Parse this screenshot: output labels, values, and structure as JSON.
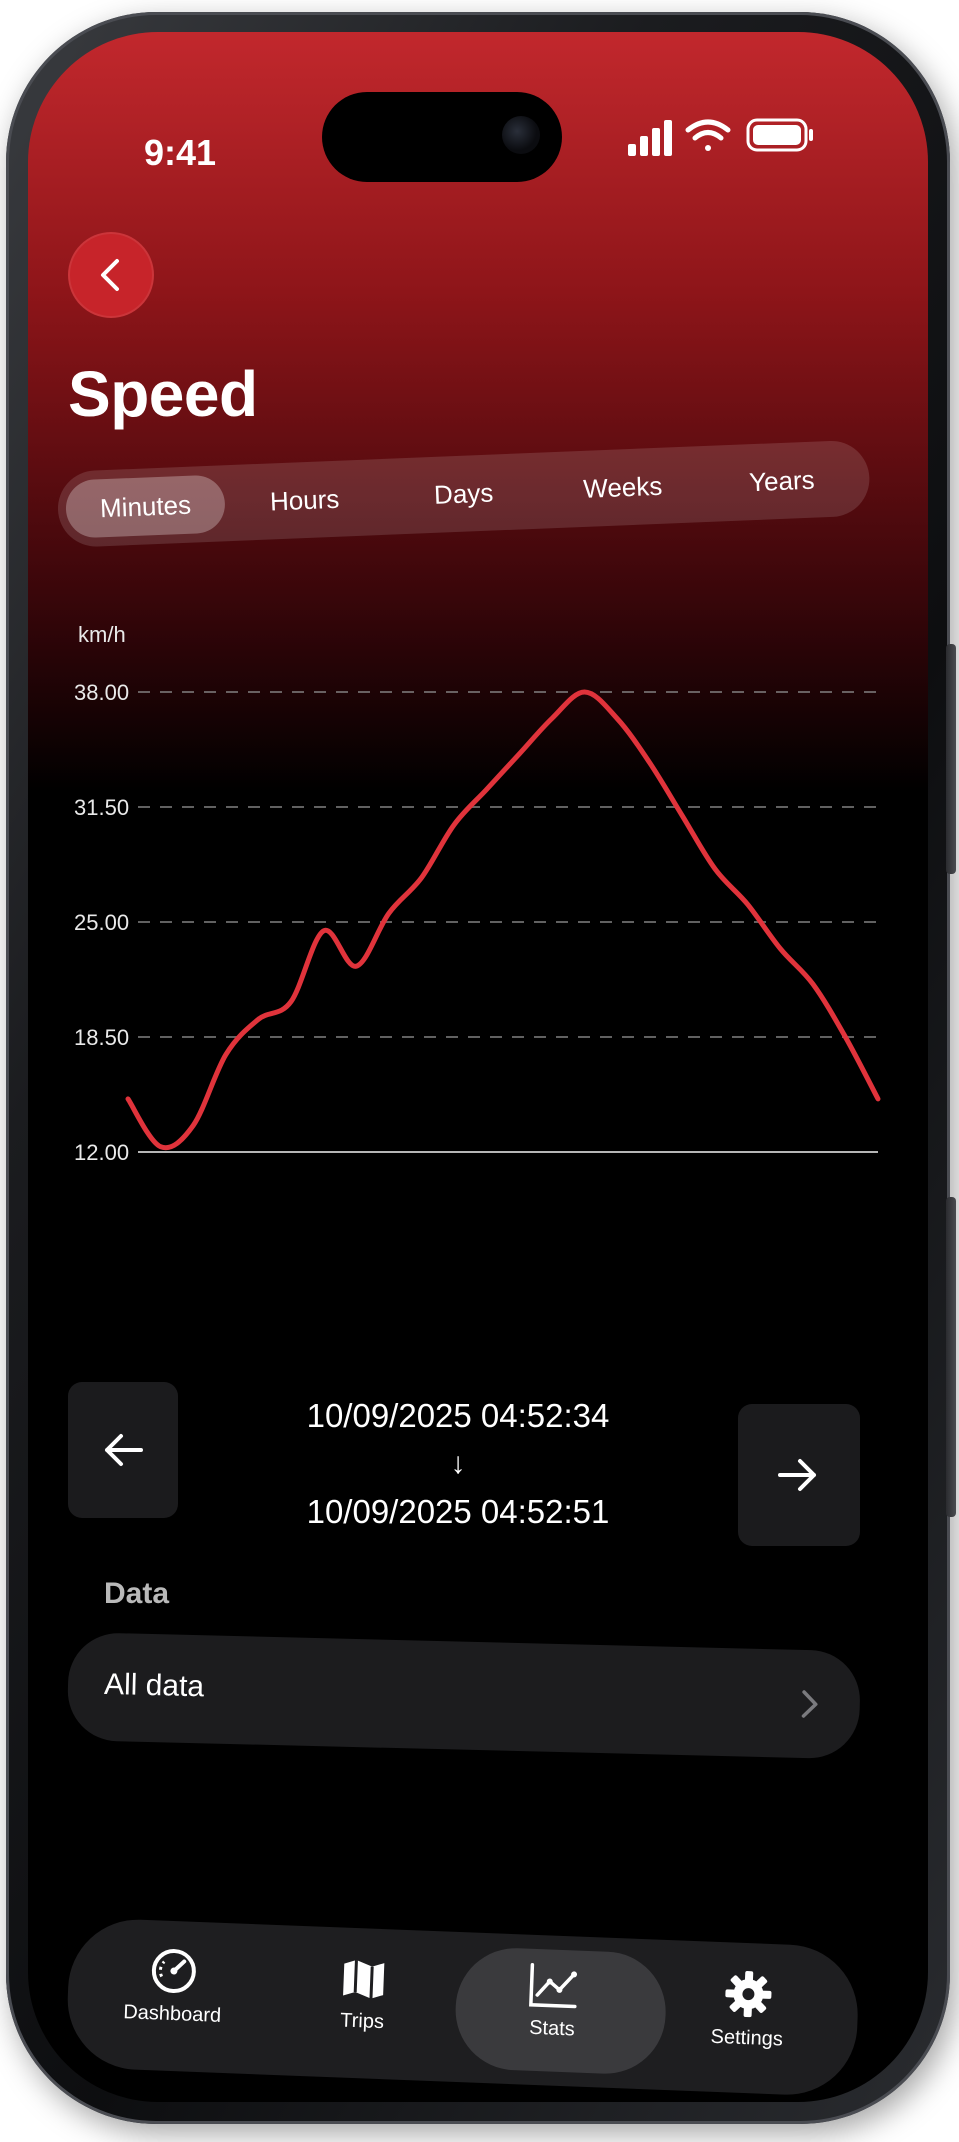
{
  "status_bar": {
    "time": "9:41"
  },
  "header": {
    "title": "Speed"
  },
  "tabs": [
    {
      "label": "Minutes",
      "active": true
    },
    {
      "label": "Hours",
      "active": false
    },
    {
      "label": "Days",
      "active": false
    },
    {
      "label": "Weeks",
      "active": false
    },
    {
      "label": "Years",
      "active": false
    }
  ],
  "chart_data": {
    "type": "line",
    "ylabel": "km/h",
    "ylim": [
      12.0,
      38.0
    ],
    "yticks": [
      "38.00",
      "31.50",
      "25.00",
      "18.50",
      "12.00"
    ],
    "grid": true,
    "series": [
      {
        "values": [
          15.0,
          12.3,
          13.5,
          17.5,
          19.5,
          20.5,
          24.5,
          22.5,
          25.5,
          27.5,
          30.5,
          32.5,
          34.5,
          36.5,
          38.0,
          36.5,
          34.0,
          31.0,
          28.0,
          26.0,
          23.5,
          21.5,
          18.5,
          15.0
        ]
      }
    ],
    "color": "#e0333b"
  },
  "range": {
    "start": "10/09/2025 04:52:34",
    "separator": "↓",
    "end": "10/09/2025 04:52:51"
  },
  "data_section": {
    "label": "Data",
    "item": "All data"
  },
  "tabbar": {
    "items": [
      {
        "label": "Dashboard",
        "icon": "speedometer-icon",
        "active": false
      },
      {
        "label": "Trips",
        "icon": "map-icon",
        "active": false
      },
      {
        "label": "Stats",
        "icon": "chart-line-icon",
        "active": true
      },
      {
        "label": "Settings",
        "icon": "gear-icon",
        "active": false
      }
    ]
  },
  "colors": {
    "accent": "#c7242a",
    "line": "#e0333b",
    "surface": "#1c1c1e"
  }
}
